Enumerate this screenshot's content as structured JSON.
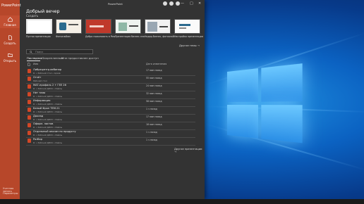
{
  "app": {
    "brand": "PowerPoint",
    "title": "PowerPoint",
    "window_controls": [
      "—",
      "□",
      "✕"
    ]
  },
  "sidebar": {
    "items": [
      {
        "label": "Главная",
        "icon": "home-icon"
      },
      {
        "label": "Создать",
        "icon": "new-file-icon"
      },
      {
        "label": "Открыть",
        "icon": "folder-icon"
      }
    ],
    "bottom": [
      "Учетная запись",
      "Параметры"
    ]
  },
  "main": {
    "greeting": "Добрый вечер",
    "new_section": "Создать",
    "templates": [
      {
        "label": "Пустая презентация"
      },
      {
        "label": "Фотоальбом"
      },
      {
        "label": "Добро пожаловать в PowerPoint"
      },
      {
        "label": "Презентация бизнес-плана"
      },
      {
        "label": "Надир-бизнес, фотоальбом"
      },
      {
        "label": "Настройка презентации"
      }
    ],
    "more_themes": "Другие темы →",
    "search_placeholder": "Поиск",
    "tabs": [
      "Последние",
      "Закрепленные",
      "Мне предоставлен доступ"
    ],
    "list_header": {
      "name": "Имя",
      "date": "Дата изменения"
    },
    "files": [
      {
        "name": "Либрецентр-вебинар",
        "path": "D: » Рабочий стол » Архив",
        "date": "17 мин назад"
      },
      {
        "name": "Отчёт",
        "path": "Рабочий стол",
        "date": "55 мин назад"
      },
      {
        "name": "МАТ-профиль 2 + ГЕЕ 26",
        "path": "D: » Рабочий ДИСК » Файлы",
        "date": "24 мин назад"
      },
      {
        "name": "Нет тема",
        "path": "D: » Рабочий ДИСК » Файлы",
        "date": "32 мин назад"
      },
      {
        "name": "Информация",
        "path": "D: » Рабочий ДИСК » Файлы",
        "date": "58 мин назад"
      },
      {
        "name": "Белый Фрон ТЕМ.21",
        "path": "D: » Рабочий ДИСК » Файлы",
        "date": "1 ч назад"
      },
      {
        "name": "Доклад",
        "path": "D: » Рабочий ДИСК » Файлы",
        "date": "17 мин назад"
      },
      {
        "name": "Оформ. листов",
        "path": "D: » Рабочий ДИСК » Файлы",
        "date": "18 мин назад"
      },
      {
        "name": "Отдельный анализ по продукту",
        "path": "D: » Рабочий ДИСК » Файлы",
        "date": "1 ч назад"
      },
      {
        "name": "Разбор",
        "path": "D: » Рабочий ДИСК » Файлы",
        "date": "1 ч назад"
      }
    ],
    "more_presentations": "Другие презентации →"
  }
}
